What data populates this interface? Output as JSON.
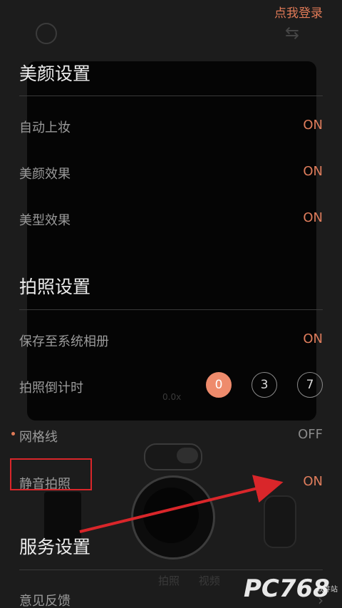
{
  "header": {
    "login_link": "点我登录"
  },
  "camera_bg": {
    "zoom": "0.0x",
    "tabs": [
      "拍照",
      "视频"
    ]
  },
  "sections": {
    "beauty": {
      "title": "美颜设置",
      "rows": [
        {
          "label": "自动上妆",
          "value": "ON"
        },
        {
          "label": "美颜效果",
          "value": "ON"
        },
        {
          "label": "美型效果",
          "value": "ON"
        }
      ]
    },
    "photo": {
      "title": "拍照设置",
      "rows": [
        {
          "label": "保存至系统相册",
          "value": "ON"
        },
        {
          "label": "拍照倒计时",
          "options": [
            "0",
            "3",
            "7"
          ],
          "selected": "0"
        },
        {
          "label": "网格线",
          "value": "OFF"
        },
        {
          "label": "静音拍照",
          "value": "ON"
        }
      ]
    },
    "service": {
      "title": "服务设置",
      "rows": [
        {
          "label": "意见反馈"
        }
      ]
    }
  },
  "watermark": {
    "main": "PC768",
    "sub": "软件站"
  },
  "icons": {
    "top_left": "camera-mode-icon",
    "top_right": "switch-camera-icon",
    "row_chevron": "chevron-right-icon"
  },
  "colors": {
    "accent": "#e07a57",
    "annotation": "#d9262a"
  }
}
